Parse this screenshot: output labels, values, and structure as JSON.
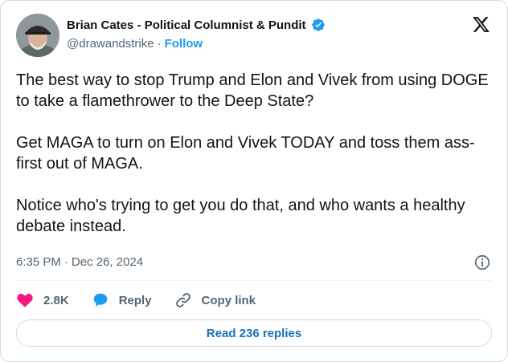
{
  "author": {
    "display_name": "Brian Cates - Political Columnist & Pundit",
    "handle": "@drawandstrike",
    "separator": "·",
    "follow_label": "Follow"
  },
  "tweet": {
    "paragraphs": [
      "The best way to stop Trump and Elon and Vivek from using DOGE to take a flamethrower to the Deep State?",
      "Get MAGA to turn on Elon and Vivek TODAY and toss them ass-first out of MAGA.",
      "Notice who's trying to get you do that, and who wants a healthy debate instead."
    ],
    "time": "6:35 PM",
    "separator": "·",
    "date": "Dec 26, 2024"
  },
  "actions": {
    "likes": "2.8K",
    "reply_label": "Reply",
    "copy_link_label": "Copy link"
  },
  "replies_button": "Read 236 replies",
  "colors": {
    "brand_blue": "#1d9bf0",
    "like_pink": "#f91880",
    "text_primary": "#0f1419",
    "text_secondary": "#536471",
    "border": "#cfd9de"
  },
  "icons": [
    "verified-badge-icon",
    "x-logo-icon",
    "info-icon",
    "heart-icon",
    "reply-bubble-icon",
    "link-icon"
  ]
}
